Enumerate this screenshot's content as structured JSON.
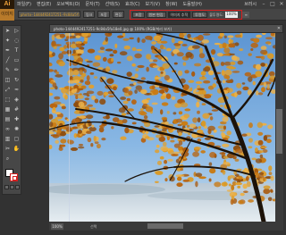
{
  "app": {
    "logo": "Ai"
  },
  "menubar": {
    "items": [
      "파일(F)",
      "편집(E)",
      "오브젝트(O)",
      "문자(T)",
      "선택(S)",
      "효과(C)",
      "보기(V)",
      "창(W)",
      "도움말(H)",
      "브러시"
    ],
    "window_controls": [
      "–",
      "□",
      "✕"
    ]
  },
  "controlbar": {
    "selection_label": "이미지",
    "file_name": "photo-1444492417251-9c84a5fa18e0.jpg",
    "buttons": [
      "링크",
      "포함",
      "편집"
    ],
    "highlight_buttons": [
      "포함",
      "원본 편집",
      "이미지 추적",
      "투명도",
      "불투명도:",
      "100%"
    ],
    "opacity_label": "불투명도:",
    "opacity_value": "100%"
  },
  "document": {
    "tab_title": "photo-1444492417251-9c84a5fa18e0.jpg @ 100% (RGB/미리 보기)",
    "close": "✕",
    "zoom": "100%",
    "status": "선택"
  },
  "colors": {
    "accent": "#d42020",
    "selection_tab": "#b87a2a",
    "sky": "#7fb0e0",
    "foliage": "#d08a20"
  },
  "icons": [
    "selection-tool-icon",
    "direct-selection-tool-icon",
    "magic-wand-icon",
    "lasso-icon",
    "pen-icon",
    "type-icon",
    "line-icon",
    "rectangle-icon",
    "paintbrush-icon",
    "pencil-icon",
    "eraser-icon",
    "rotate-icon",
    "scale-icon",
    "warp-icon",
    "free-transform-icon",
    "shape-builder-icon",
    "perspective-icon",
    "mesh-icon",
    "gradient-icon",
    "eyedropper-icon",
    "blend-icon",
    "symbol-sprayer-icon",
    "column-graph-icon",
    "artboard-icon",
    "slice-icon",
    "hand-icon",
    "zoom-icon"
  ]
}
